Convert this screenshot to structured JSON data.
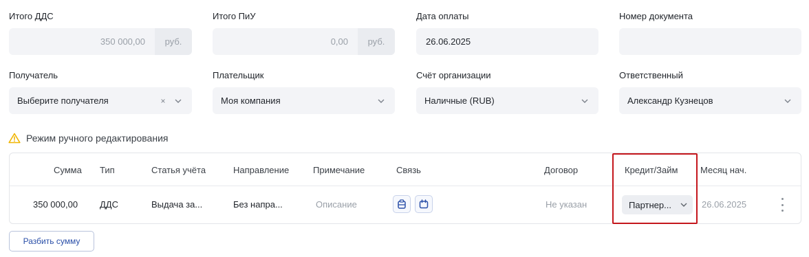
{
  "totals": {
    "dds": {
      "label": "Итого ДДС",
      "amount": "350 000,00",
      "unit": "руб."
    },
    "piu": {
      "label": "Итого ПиУ",
      "amount": "0,00",
      "unit": "руб."
    },
    "payment_date": {
      "label": "Дата оплаты",
      "value": "26.06.2025"
    },
    "document_number": {
      "label": "Номер документа",
      "value": ""
    }
  },
  "selects": {
    "recipient": {
      "label": "Получатель",
      "value": "Выберите получателя",
      "clear": "×"
    },
    "payer": {
      "label": "Плательщик",
      "value": "Моя компания"
    },
    "org_account": {
      "label": "Счёт организации",
      "value": "Наличные (RUB)"
    },
    "responsible": {
      "label": "Ответственный",
      "value": "Александр Кузнецов"
    }
  },
  "warning": {
    "icon": "warning-triangle-icon",
    "text": "Режим ручного редактирования",
    "color": "#f0b400"
  },
  "table": {
    "headers": {
      "amount": "Сумма",
      "type": "Тип",
      "article": "Статья учёта",
      "direction": "Направление",
      "note": "Примечание",
      "link": "Связь",
      "contract": "Договор",
      "credit": "Кредит/Займ",
      "month_start": "Месяц нач."
    },
    "rows": [
      {
        "amount": "350 000,00",
        "type": "ДДС",
        "article": "Выдача за...",
        "direction": "Без напра...",
        "note": "Описание",
        "contract": "Не указан",
        "credit": "Партнер...",
        "month_start": "26.06.2025"
      }
    ]
  },
  "actions": {
    "split_amount": "Разбить сумму"
  },
  "colors": {
    "accent": "#2a4fa8",
    "highlight": "#c4161c",
    "field_bg": "#f3f4f7"
  }
}
